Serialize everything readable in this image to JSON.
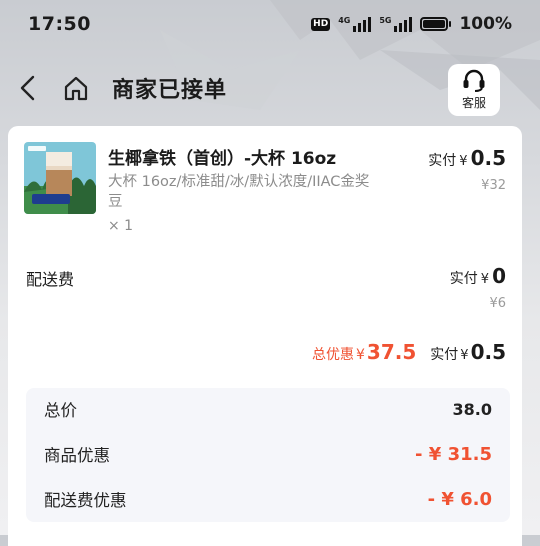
{
  "status_bar": {
    "time": "17:50",
    "hd_badge": "HD",
    "net1": "4G",
    "net2": "5G",
    "battery_pct": "100%"
  },
  "nav": {
    "back_icon": "chevron-left-icon",
    "home_icon": "home-icon",
    "title": "商家已接单",
    "service_icon": "headset-icon",
    "service_label": "客服"
  },
  "product": {
    "name": "生椰拿铁（首创）-大杯 16oz",
    "spec": "大杯 16oz/标准甜/冰/默认浓度/IIAC金奖豆",
    "qty": "× 1",
    "paid_label": "实付",
    "currency": "¥",
    "paid_value": "0.5",
    "original_price": "¥32"
  },
  "delivery": {
    "label": "配送费",
    "paid_label": "实付",
    "currency": "¥",
    "paid_value": "0",
    "original_price": "¥6"
  },
  "totals": {
    "discount_label": "总优惠",
    "discount_currency": "¥",
    "discount_value": "37.5",
    "paid_label": "实付",
    "paid_currency": "¥",
    "paid_value": "0.5"
  },
  "summary": {
    "rows": [
      {
        "label": "总价",
        "value": "38.0"
      },
      {
        "label": "商品优惠",
        "value": "- ¥ 31.5"
      },
      {
        "label": "配送费优惠",
        "value": "- ¥ 6.0"
      }
    ]
  },
  "colors": {
    "accent_red": "#f05232",
    "text": "#1b1b1b",
    "muted": "#8c8c8c"
  }
}
